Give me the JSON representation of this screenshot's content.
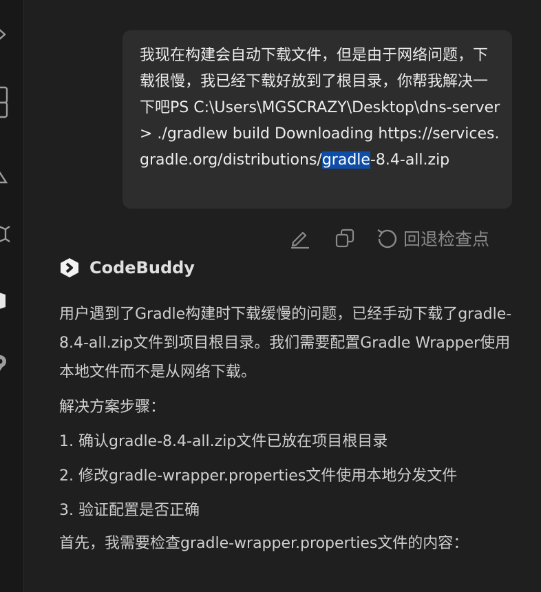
{
  "user_message": {
    "text_before": "我现在构建会自动下载文件，但是由于网络问题，下载很慢，我已经下载好放到了根目录，你帮我解决一下吧PS C:\\Users\\MGSCRAZY\\Desktop\\dns-server> ./gradlew build Downloading https://services.gradle.org/distributions/",
    "text_selected": "gradle",
    "text_after": "-8.4-all.zip"
  },
  "message_actions": {
    "edit_icon": "pencil-icon",
    "copy_icon": "copy-icon",
    "checkpoint_icon": "undo-icon",
    "checkpoint_label": "回退检查点"
  },
  "assistant": {
    "name": "CodeBuddy",
    "logo_icon": "codebuddy-logo-icon",
    "paragraphs": [
      "用户遇到了Gradle构建时下载缓慢的问题，已经手动下载了gradle-8.4-all.zip文件到项目根目录。我们需要配置Gradle Wrapper使用本地文件而不是从网络下载。",
      "解决方案步骤：",
      "1. 确认gradle-8.4-all.zip文件已放在项目根目录",
      "2. 修改gradle-wrapper.properties文件使用本地分发文件",
      "3. 验证配置是否正确",
      "首先，我需要检查gradle-wrapper.properties文件的内容："
    ]
  },
  "activity_bar": {
    "icons": [
      "chevron-right-icon",
      "files-icon",
      "flask-icon",
      "extensions-icon",
      "codebuddy-icon",
      "map-pin-icon"
    ]
  },
  "colors": {
    "background": "#1f1f1f",
    "bubble": "#2d2d2d",
    "selection": "#0e4da8",
    "text": "#cfcfcf"
  }
}
